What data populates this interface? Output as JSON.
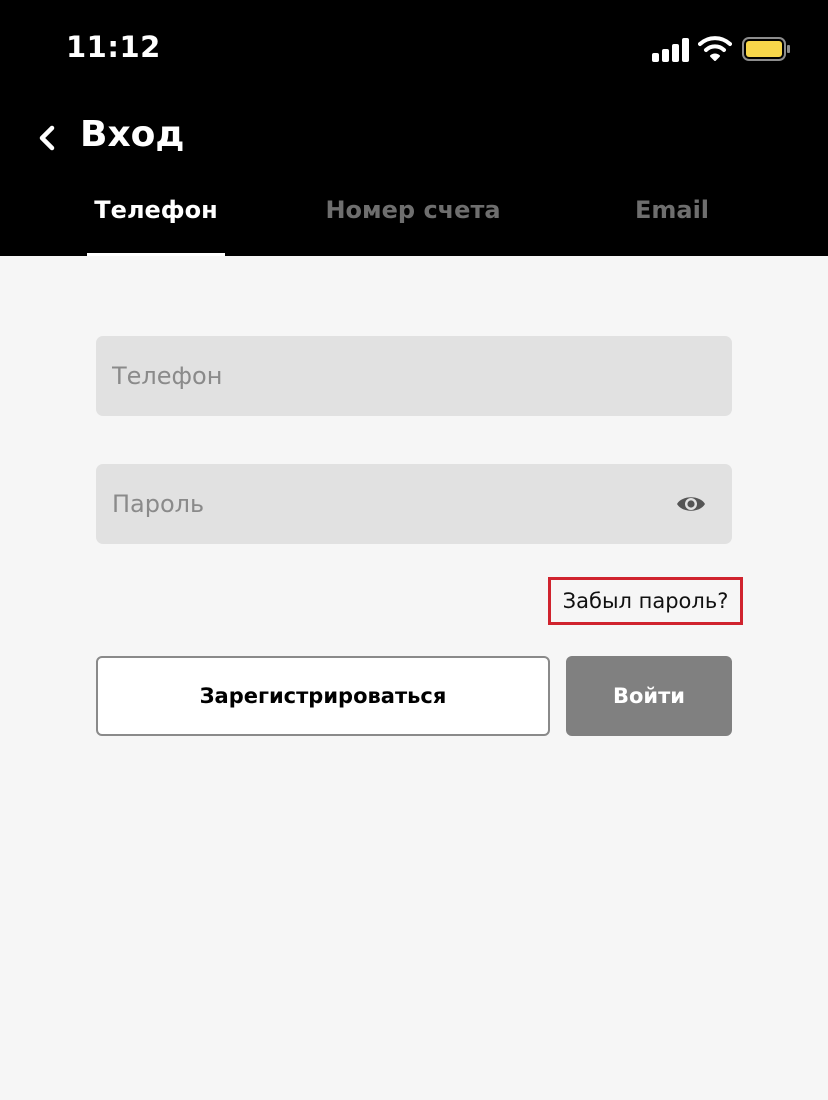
{
  "status_bar": {
    "time": "11:12",
    "icons": [
      "signal-icon",
      "wifi-icon",
      "battery-icon"
    ],
    "battery_color": "#f7d64a"
  },
  "header": {
    "title": "Вход",
    "back_icon": "chevron-left-icon"
  },
  "tabs": [
    {
      "label": "Телефон",
      "active": true
    },
    {
      "label": "Номер счета",
      "active": false
    },
    {
      "label": "Email",
      "active": false
    }
  ],
  "form": {
    "phone": {
      "placeholder": "Телефон",
      "value": ""
    },
    "password": {
      "placeholder": "Пароль",
      "value": "",
      "toggle_icon": "eye-icon"
    },
    "forgot_label": "Забыл пароль?",
    "register_label": "Зарегистрироваться",
    "login_label": "Войти"
  },
  "colors": {
    "header_bg": "#000000",
    "page_bg": "#f6f6f6",
    "highlight_border": "#d0232e",
    "login_button": "#808080"
  }
}
